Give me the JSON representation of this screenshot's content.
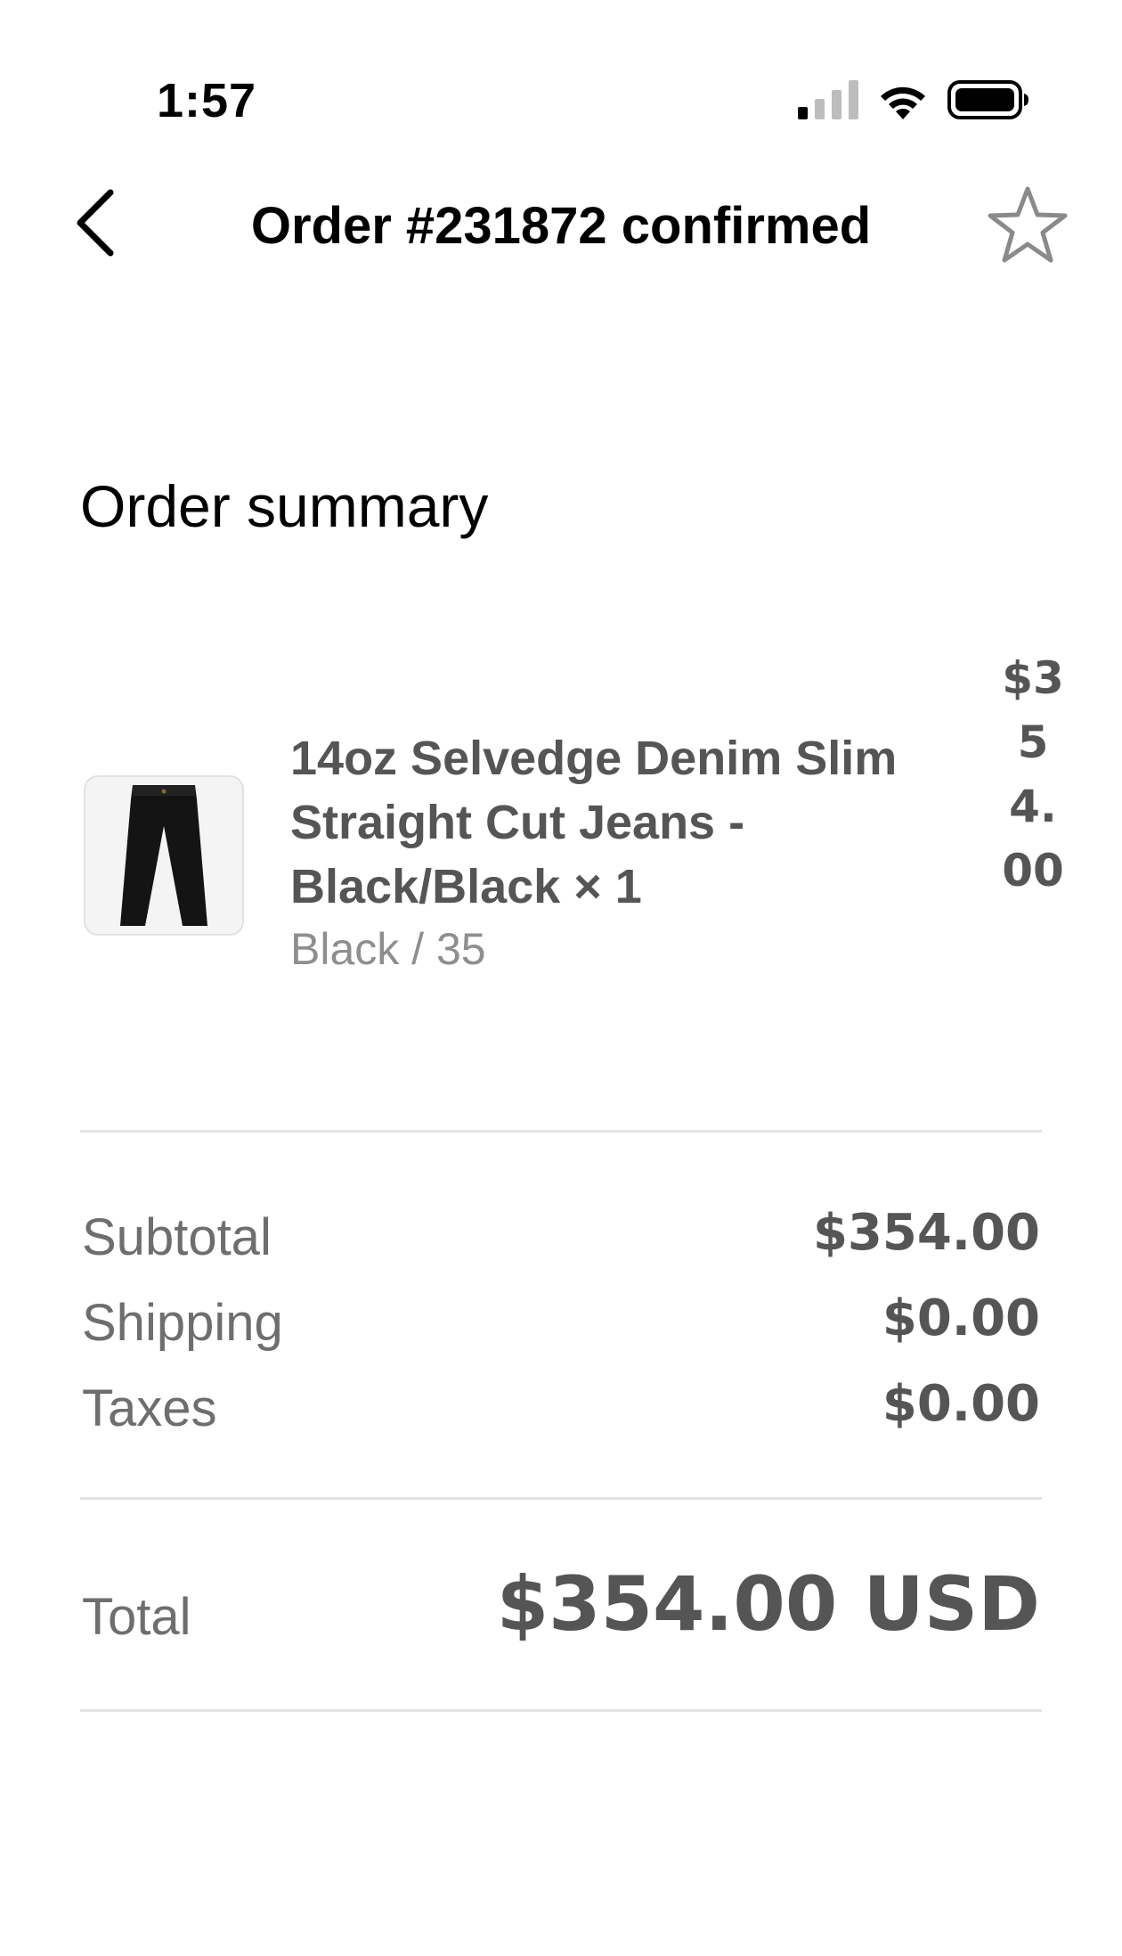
{
  "status_bar": {
    "time": "1:57",
    "icons": [
      "cellular-signal-icon",
      "wifi-icon",
      "battery-icon"
    ]
  },
  "header": {
    "title": "Order #231872 confirmed",
    "back_icon": "chevron-left-icon",
    "favorite_icon": "star-outline-icon"
  },
  "summary": {
    "title": "Order summary",
    "items": [
      {
        "name": "14oz Selvedge Denim Slim Straight Cut Jeans - Black/Black × 1",
        "variant": "Black / 35",
        "price": "$354.00",
        "image_icon": "jeans-thumbnail"
      }
    ],
    "rows": [
      {
        "label": "Subtotal",
        "value": "$354.00"
      },
      {
        "label": "Shipping",
        "value": "$0.00"
      },
      {
        "label": "Taxes",
        "value": "$0.00"
      }
    ],
    "total": {
      "label": "Total",
      "value": "$354.00 USD"
    }
  },
  "colors": {
    "text_primary": "#000000",
    "text_secondary": "#555555",
    "text_muted": "#8e8e8e",
    "divider": "#e3e3e3"
  }
}
